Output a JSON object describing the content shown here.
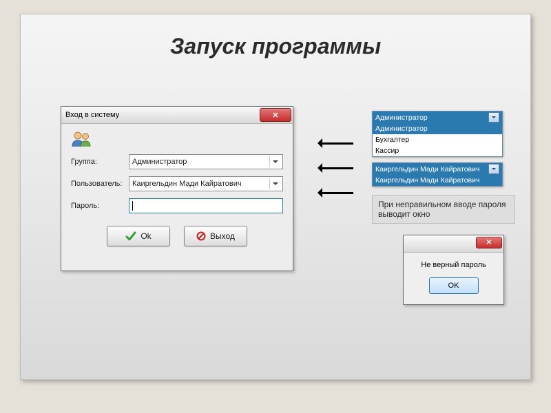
{
  "slide": {
    "title": "Запуск программы"
  },
  "login": {
    "window_title": "Вход в систему",
    "labels": {
      "group": "Группа:",
      "user": "Пользователь:",
      "password": "Пароль:"
    },
    "values": {
      "group": "Администратор",
      "user": "Каиргельдин Мади Кайратович",
      "password": ""
    },
    "buttons": {
      "ok": "Ok",
      "exit": "Выход"
    }
  },
  "group_dropdown": {
    "selected": "Администратор",
    "options": [
      "Администратор",
      "Бухгалтер",
      "Кассир"
    ]
  },
  "user_dropdown": {
    "selected": "Каиргельдин Мади Кайратович",
    "options": [
      "Каиргельдин Мади Кайратович"
    ]
  },
  "note": {
    "text": "При неправильном вводе пароля выводит окно"
  },
  "error_dialog": {
    "message": "Не верный пароль",
    "ok": "OK"
  }
}
